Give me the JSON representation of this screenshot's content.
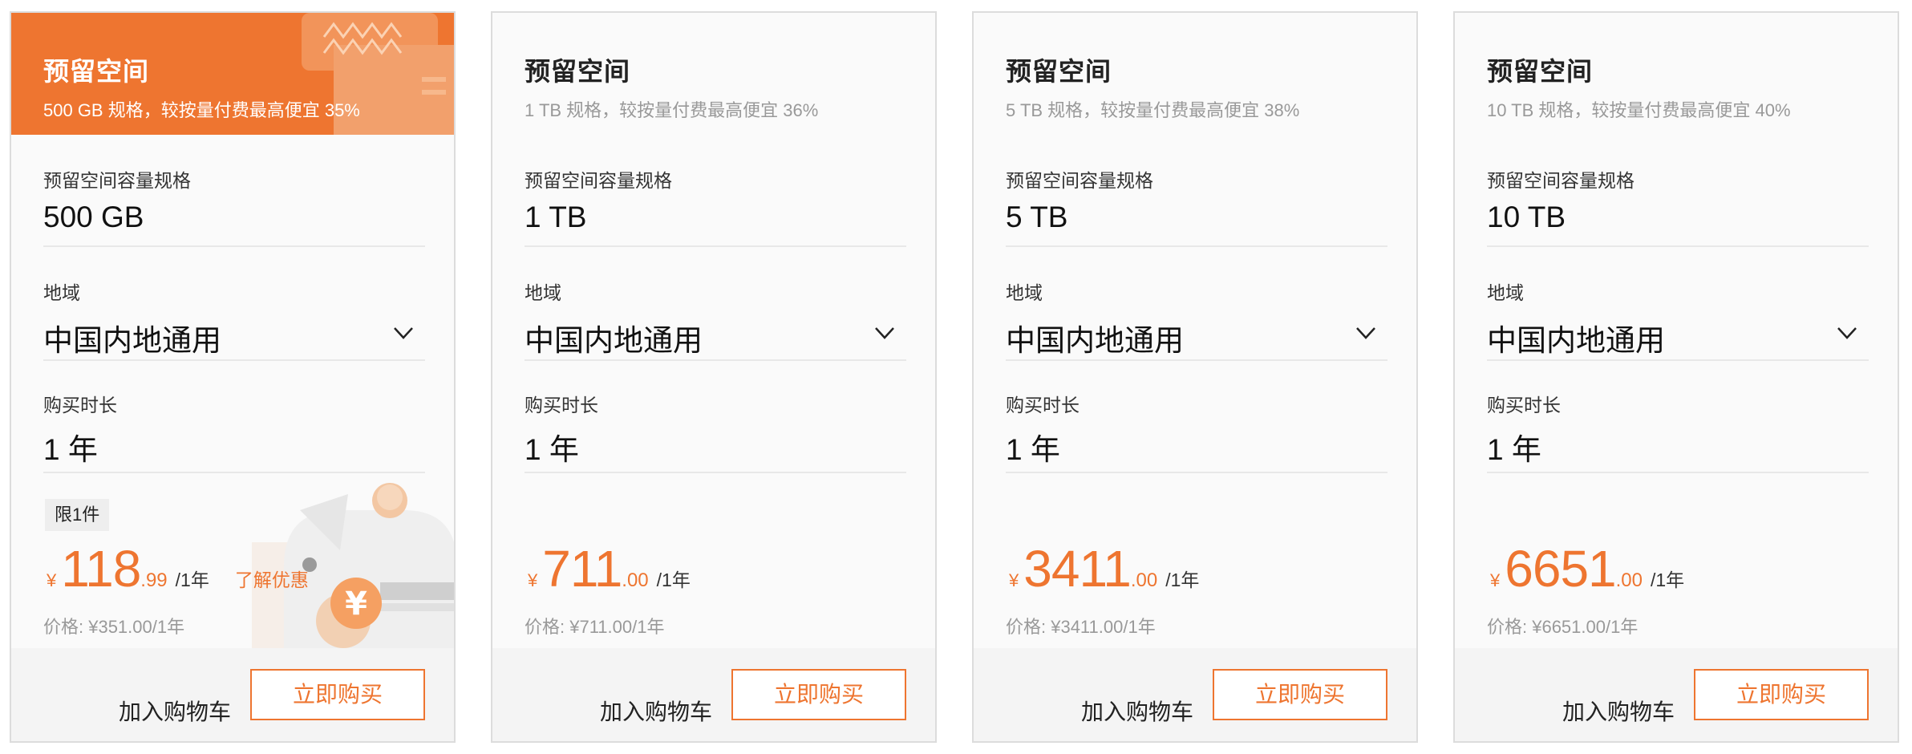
{
  "colors": {
    "accent": "#ee7530",
    "border": "#dcdcdc",
    "muted": "#999999"
  },
  "cards": [
    {
      "title": "预留空间",
      "subtitle": "500 GB 规格，较按量付费最高便宜 35%",
      "capacity_label": "预留空间容量规格",
      "capacity_value": "500 GB",
      "region_label": "地域",
      "region_value": "中国内地通用",
      "duration_label": "购买时长",
      "duration_value": "1 年",
      "limit_badge": "限1件",
      "currency": "¥",
      "price_int": "118",
      "price_dec": ".99",
      "per": "/1年",
      "promo_link": "了解优惠",
      "orig_price": "价格: ¥351.00/1年",
      "add_cart": "加入购物车",
      "buy": "立即购买"
    },
    {
      "title": "预留空间",
      "subtitle": "1 TB 规格，较按量付费最高便宜 36%",
      "capacity_label": "预留空间容量规格",
      "capacity_value": "1 TB",
      "region_label": "地域",
      "region_value": "中国内地通用",
      "duration_label": "购买时长",
      "duration_value": "1 年",
      "currency": "¥",
      "price_int": "711",
      "price_dec": ".00",
      "per": "/1年",
      "orig_price": "价格: ¥711.00/1年",
      "add_cart": "加入购物车",
      "buy": "立即购买"
    },
    {
      "title": "预留空间",
      "subtitle": "5 TB 规格，较按量付费最高便宜 38%",
      "capacity_label": "预留空间容量规格",
      "capacity_value": "5 TB",
      "region_label": "地域",
      "region_value": "中国内地通用",
      "duration_label": "购买时长",
      "duration_value": "1 年",
      "currency": "¥",
      "price_int": "3411",
      "price_dec": ".00",
      "per": "/1年",
      "orig_price": "价格: ¥3411.00/1年",
      "add_cart": "加入购物车",
      "buy": "立即购买"
    },
    {
      "title": "预留空间",
      "subtitle": "10 TB 规格，较按量付费最高便宜 40%",
      "capacity_label": "预留空间容量规格",
      "capacity_value": "10 TB",
      "region_label": "地域",
      "region_value": "中国内地通用",
      "duration_label": "购买时长",
      "duration_value": "1 年",
      "currency": "¥",
      "price_int": "6651",
      "price_dec": ".00",
      "per": "/1年",
      "orig_price": "价格: ¥6651.00/1年",
      "add_cart": "加入购物车",
      "buy": "立即购买"
    }
  ]
}
